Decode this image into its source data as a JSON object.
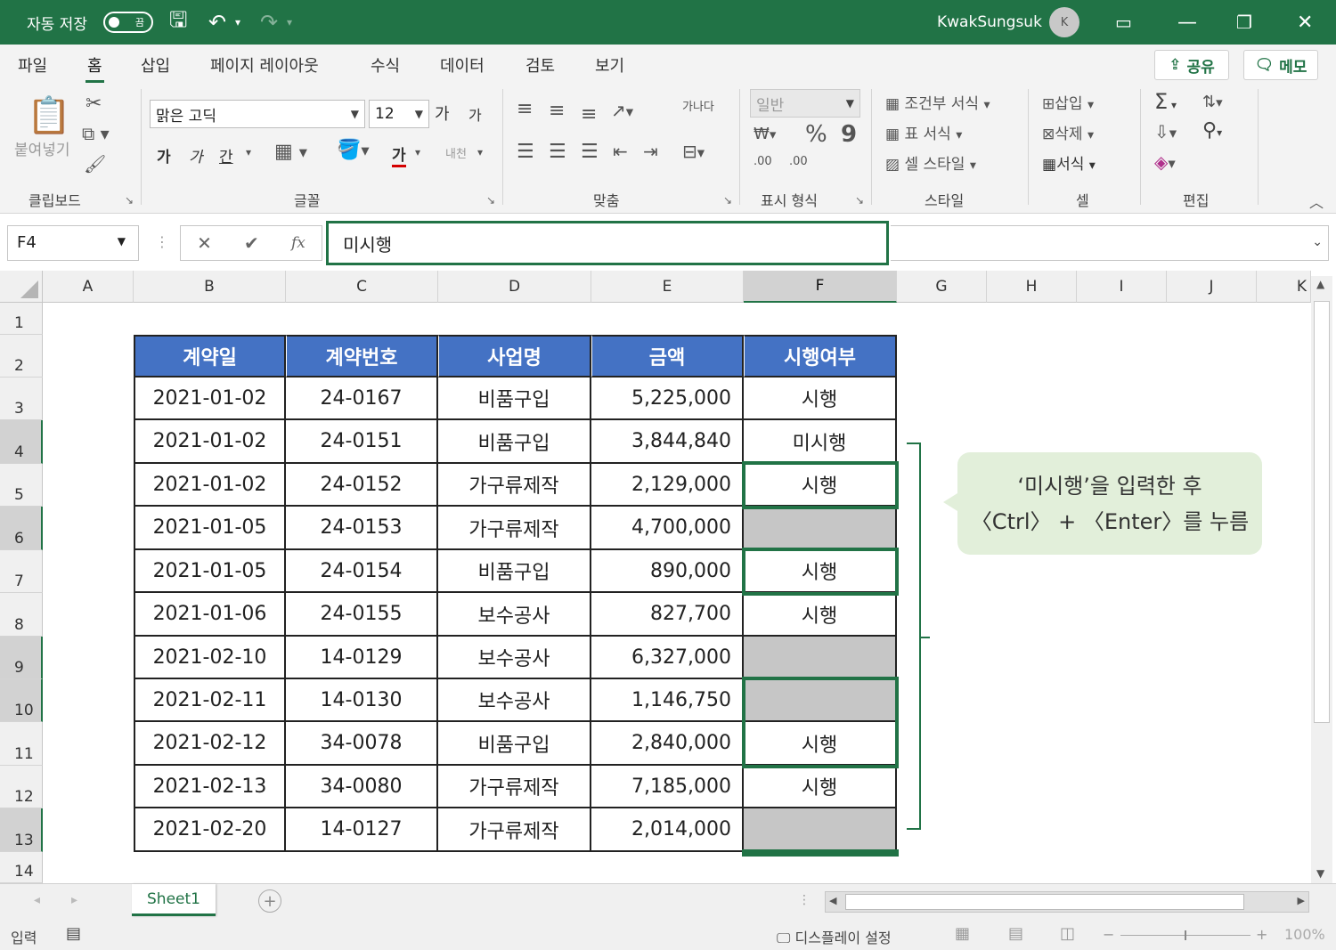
{
  "titlebar": {
    "autosave_label": "자동 저장",
    "autosave_state": "끔",
    "username": "KwakSungsuk",
    "avatar_initial": "K"
  },
  "menu": {
    "tabs": [
      "파일",
      "홈",
      "삽입",
      "페이지 레이아웃",
      "수식",
      "데이터",
      "검토",
      "보기"
    ],
    "active_tab": "홈",
    "share_label": "공유",
    "memo_label": "메모"
  },
  "ribbon": {
    "clipboard": {
      "paste_label": "붙여넣기",
      "group_label": "클립보드"
    },
    "font": {
      "font_name": "맑은 고딕",
      "font_size": "12",
      "grow_label": "가",
      "shrink_label": "가",
      "bold": "가",
      "italic": "가",
      "underline": "간",
      "color_label": "가",
      "phonetic_label": "내천",
      "group_label": "글꼴"
    },
    "alignment": {
      "wrap_label": "가나다",
      "group_label": "맞춤"
    },
    "number": {
      "format": "일반",
      "percent": "%",
      "comma": "9",
      "increase_decimal": ".00",
      "decrease_decimal": ".00",
      "group_label": "표시 형식"
    },
    "styles": {
      "conditional_label": "조건부 서식",
      "table_label": "표 서식",
      "cell_styles_label": "셀 스타일",
      "group_label": "스타일"
    },
    "cells": {
      "insert_label": "삽입",
      "delete_label": "삭제",
      "format_label": "서식",
      "group_label": "셀"
    },
    "editing": {
      "group_label": "편집"
    }
  },
  "formula_bar": {
    "name_box": "F4",
    "cancel_symbol": "✕",
    "enter_symbol": "✔",
    "fx_symbol": "fx",
    "content": "미시행"
  },
  "columns": [
    "A",
    "B",
    "C",
    "D",
    "E",
    "F",
    "G",
    "H",
    "I",
    "J",
    "K"
  ],
  "rows": [
    "1",
    "2",
    "3",
    "4",
    "5",
    "6",
    "7",
    "8",
    "9",
    "10",
    "11",
    "12",
    "13",
    "14"
  ],
  "table": {
    "headers": [
      "계약일",
      "계약번호",
      "사업명",
      "금액",
      "시행여부"
    ],
    "rows": [
      [
        "2021-01-02",
        "24-0167",
        "비품구입",
        "5,225,000",
        "시행"
      ],
      [
        "2021-01-02",
        "24-0151",
        "비품구입",
        "3,844,840",
        "미시행"
      ],
      [
        "2021-01-02",
        "24-0152",
        "가구류제작",
        "2,129,000",
        "시행"
      ],
      [
        "2021-01-05",
        "24-0153",
        "가구류제작",
        "4,700,000",
        ""
      ],
      [
        "2021-01-05",
        "24-0154",
        "비품구입",
        "890,000",
        "시행"
      ],
      [
        "2021-01-06",
        "24-0155",
        "보수공사",
        "827,700",
        "시행"
      ],
      [
        "2021-02-10",
        "14-0129",
        "보수공사",
        "6,327,000",
        ""
      ],
      [
        "2021-02-11",
        "14-0130",
        "보수공사",
        "1,146,750",
        ""
      ],
      [
        "2021-02-12",
        "34-0078",
        "비품구입",
        "2,840,000",
        "시행"
      ],
      [
        "2021-02-13",
        "34-0080",
        "가구류제작",
        "7,185,000",
        "시행"
      ],
      [
        "2021-02-20",
        "14-0127",
        "가구류제작",
        "2,014,000",
        ""
      ]
    ]
  },
  "callout": {
    "line1": "‘미시행’을 입력한 후",
    "line2": "〈Ctrl〉 + 〈Enter〉를 누름"
  },
  "sheet_tabs": {
    "active": "Sheet1"
  },
  "statusbar": {
    "mode": "입력",
    "display_settings": "디스플레이 설정",
    "zoom": "100%"
  },
  "colors": {
    "excel_green": "#217346",
    "header_blue": "#4472c4",
    "empty_gray": "#c6c6c6",
    "callout_bg": "#e2efda"
  }
}
